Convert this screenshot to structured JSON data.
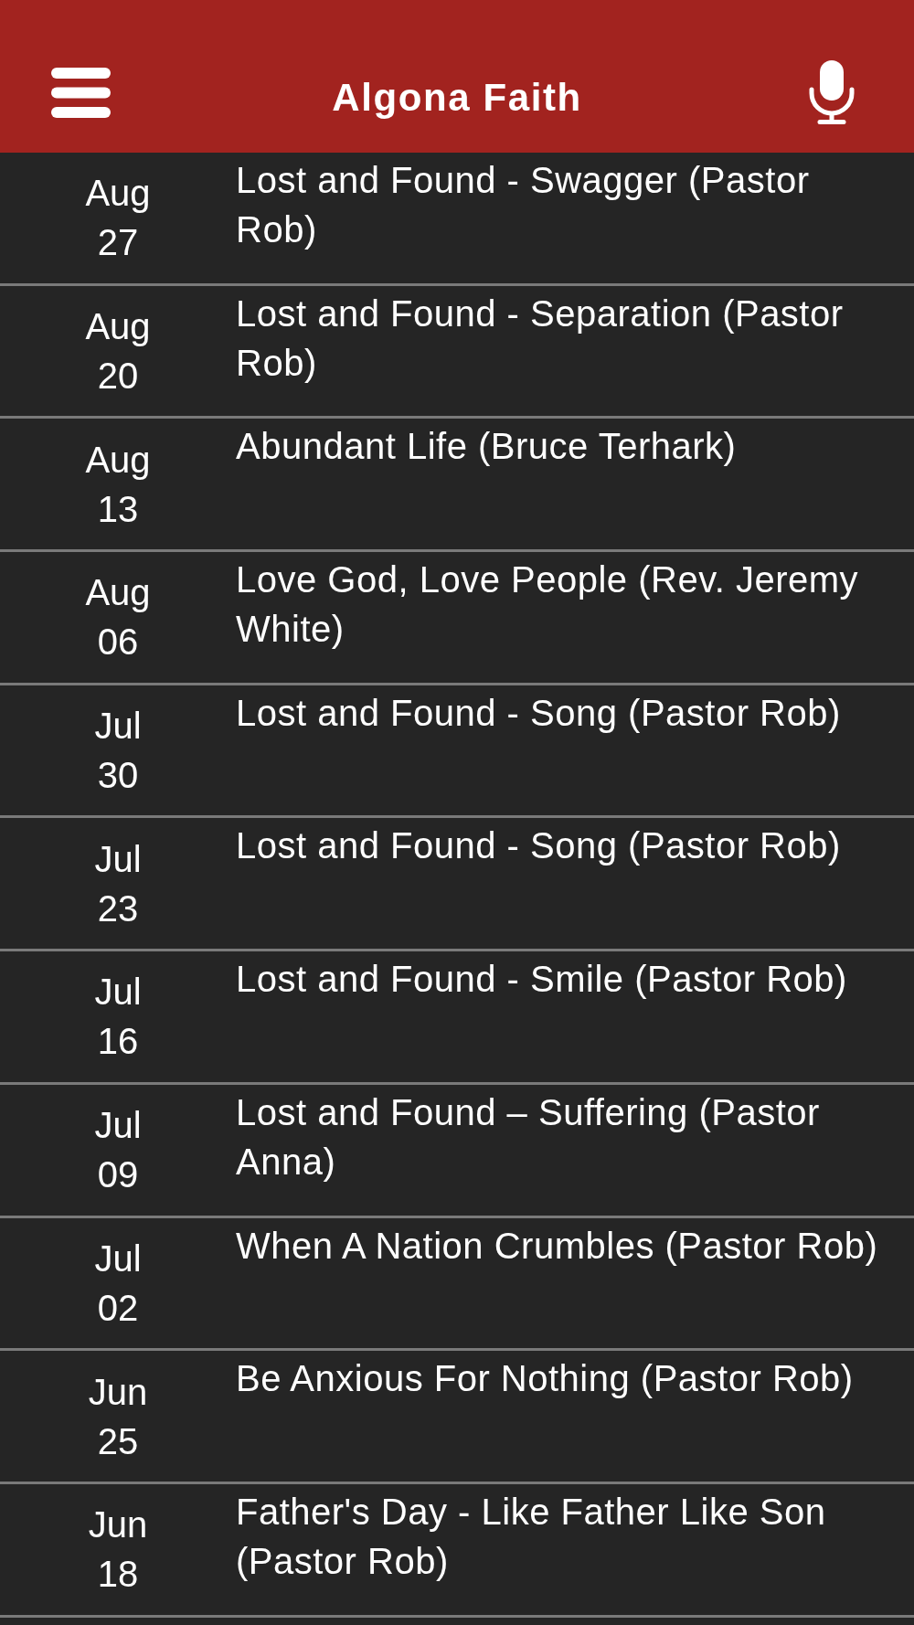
{
  "header": {
    "title": "Algona Faith"
  },
  "sermons": [
    {
      "month": "Aug",
      "day": "27",
      "title": "Lost and Found - Swagger (Pastor Rob)"
    },
    {
      "month": "Aug",
      "day": "20",
      "title": "Lost and Found - Separation (Pastor Rob)"
    },
    {
      "month": "Aug",
      "day": "13",
      "title": "Abundant Life (Bruce Terhark)"
    },
    {
      "month": "Aug",
      "day": "06",
      "title": "Love God, Love People (Rev. Jeremy White)"
    },
    {
      "month": "Jul",
      "day": "30",
      "title": "Lost and Found - Song (Pastor Rob)"
    },
    {
      "month": "Jul",
      "day": "23",
      "title": "Lost and Found - Song (Pastor Rob)"
    },
    {
      "month": "Jul",
      "day": "16",
      "title": "Lost and Found - Smile (Pastor Rob)"
    },
    {
      "month": "Jul",
      "day": "09",
      "title": "Lost and Found – Suffering (Pastor Anna)"
    },
    {
      "month": "Jul",
      "day": "02",
      "title": "When A Nation Crumbles (Pastor Rob)"
    },
    {
      "month": "Jun",
      "day": "25",
      "title": "Be Anxious For Nothing (Pastor Rob)"
    },
    {
      "month": "Jun",
      "day": "18",
      "title": "Father's Day - Like Father Like Son (Pastor Rob)"
    }
  ]
}
